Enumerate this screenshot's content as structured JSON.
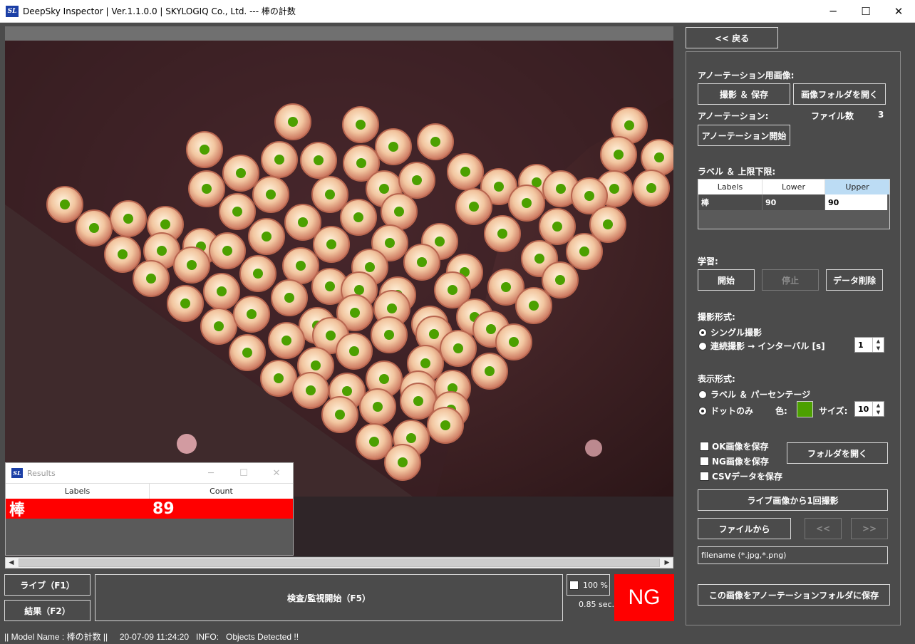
{
  "window": {
    "title": "DeepSky Inspector | Ver.1.1.0.0 | SKYLOGIQ Co., Ltd. --- 棒の計数",
    "minimize": "─",
    "maximize": "☐",
    "close": "✕"
  },
  "results_window": {
    "title": "Results",
    "headers": [
      "Labels",
      "Count"
    ],
    "row": {
      "label": "棒",
      "count": "89"
    },
    "row_color": "#ff0000"
  },
  "bottom": {
    "live_button": "ライブ（F1）",
    "result_button": "結果（F2）",
    "inspect_button": "検査/監視開始（F5）",
    "zoom_label": "100 %",
    "time_label": "0.85 sec.",
    "ng_label": "NG"
  },
  "status": {
    "text": "|| Model Name : 棒の計数 ||     20-07-09 11:24:20   INFO:   Objects Detected !!"
  },
  "panel": {
    "back_button": "<< 戻る",
    "annotation_image_label": "アノーテーション用画像:",
    "capture_save_button": "撮影 ＆ 保存",
    "open_image_folder_button": "画像フォルダを開く",
    "annotation_label": "アノーテーション:",
    "file_count_label": "ファイル数",
    "file_count_value": "3",
    "annotation_start_button": "アノーテーション開始",
    "label_limits_label": "ラベル ＆ 上限下限:",
    "limits_table": {
      "headers": [
        "Labels",
        "Lower",
        "Upper"
      ],
      "row": [
        "棒",
        "90",
        "90"
      ]
    },
    "learning_label": "学習:",
    "start_button": "開始",
    "stop_button": "停止",
    "delete_data_button": "データ削除",
    "capture_mode_label": "撮影形式:",
    "single_capture": "シングル撮影",
    "continuous_capture": "連続撮影 → インターバル [s]",
    "interval_value": "1",
    "display_mode_label": "表示形式:",
    "label_percentage": "ラベル ＆ パーセンテージ",
    "dots_only": "ドットのみ",
    "color_label": "色:",
    "dot_color": "#4ca000",
    "size_label": "サイズ:",
    "size_value": "10",
    "save_ok_images": "OK画像を保存",
    "save_ng_images": "NG画像を保存",
    "save_csv": "CSVデータを保存",
    "open_folder_button": "フォルダを開く",
    "capture_once_button": "ライブ画像から1回撮影",
    "from_file_button": "ファイルから",
    "prev_button": "<<",
    "next_button": ">>",
    "filename_placeholder": "filename (*.jpg,*.png)",
    "save_to_annotation_button": "この画像をアノーテーションフォルダに保存"
  },
  "colors": {
    "background": "#4b4b4b",
    "ng_red": "#ff0000",
    "dot_green": "#4ca000",
    "header_blue": "#bcdcf4"
  }
}
